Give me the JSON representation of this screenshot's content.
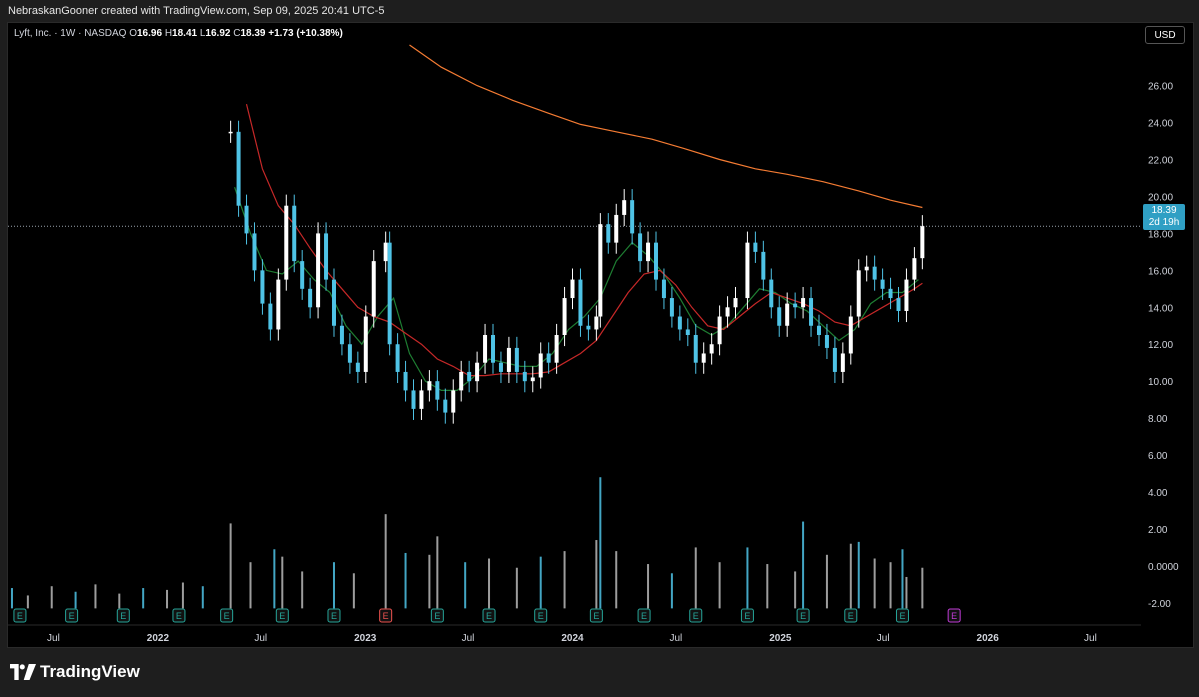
{
  "header": {
    "caption": "NebraskanGooner created with TradingView.com, Sep 09, 2025 20:41 UTC-5"
  },
  "legend": {
    "symbol": "Lyft, Inc. · 1W · NASDAQ",
    "o_label": "O",
    "o_value": "16.96",
    "h_label": "H",
    "h_value": "18.41",
    "l_label": "L",
    "l_value": "16.92",
    "c_label": "C",
    "c_value": "18.39",
    "change": "+1.73 (+10.38%)"
  },
  "price_axis": {
    "currency_label": "USD",
    "last_price": "18.39",
    "countdown": "2d 19h"
  },
  "footer": {
    "brand": "TradingView"
  },
  "colors": {
    "up": "#ffffff",
    "down": "#4fc3e6",
    "ma_short": "#1e7d32",
    "ma_mid": "#c62828",
    "ma_long": "#f57c33",
    "price_tag": "#2f9fc4",
    "earnings_green": "#26a69a",
    "earnings_red": "#ef5350",
    "earnings_future": "#c23cd8"
  },
  "chart_data": {
    "type": "candlestick",
    "symbol": "Lyft, Inc.",
    "interval": "1W",
    "exchange": "NASDAQ",
    "y_ticks": [
      "26.00",
      "24.00",
      "22.00",
      "20.00",
      "18.00",
      "16.00",
      "14.00",
      "12.00",
      "10.00",
      "8.00",
      "6.00",
      "4.00",
      "2.00",
      "0.0000",
      "-2.00"
    ],
    "y_tick_values": [
      26,
      24,
      22,
      20,
      18,
      16,
      14,
      12,
      10,
      8,
      6,
      4,
      2,
      0,
      -2
    ],
    "ylim": [
      -3.2,
      28.2
    ],
    "x_ticks": [
      "Jul",
      "2022",
      "Jul",
      "2023",
      "Jul",
      "2024",
      "Jul",
      "2025",
      "Jul",
      "2026",
      "Jul"
    ],
    "x_tick_dates": [
      "2021-07-01",
      "2022-01-01",
      "2022-07-01",
      "2023-01-01",
      "2023-07-01",
      "2024-01-01",
      "2024-07-01",
      "2025-01-01",
      "2025-07-01",
      "2026-01-01",
      "2026-07-01"
    ],
    "x_start": "2021-04-12",
    "x_end": "2026-09-28",
    "last_close": 18.39,
    "series": [
      {
        "name": "Price",
        "kind": "weekly close (approx.)",
        "points": [
          [
            "2022-05-09",
            23.5
          ],
          [
            "2022-05-23",
            19.5
          ],
          [
            "2022-06-06",
            18.0
          ],
          [
            "2022-06-20",
            16.0
          ],
          [
            "2022-07-04",
            14.2
          ],
          [
            "2022-07-18",
            12.8
          ],
          [
            "2022-08-01",
            15.5
          ],
          [
            "2022-08-15",
            19.5
          ],
          [
            "2022-08-29",
            16.5
          ],
          [
            "2022-09-12",
            15.0
          ],
          [
            "2022-09-26",
            14.0
          ],
          [
            "2022-10-10",
            18.0
          ],
          [
            "2022-10-24",
            15.5
          ],
          [
            "2022-11-07",
            13.0
          ],
          [
            "2022-11-21",
            12.0
          ],
          [
            "2022-12-05",
            11.0
          ],
          [
            "2022-12-19",
            10.5
          ],
          [
            "2023-01-02",
            13.5
          ],
          [
            "2023-01-16",
            16.5
          ],
          [
            "2023-02-06",
            17.5
          ],
          [
            "2023-02-13",
            12.0
          ],
          [
            "2023-02-27",
            10.5
          ],
          [
            "2023-03-13",
            9.5
          ],
          [
            "2023-03-27",
            8.5
          ],
          [
            "2023-04-10",
            9.5
          ],
          [
            "2023-04-24",
            10.0
          ],
          [
            "2023-05-08",
            9.0
          ],
          [
            "2023-05-22",
            8.3
          ],
          [
            "2023-06-05",
            9.5
          ],
          [
            "2023-06-19",
            10.5
          ],
          [
            "2023-07-03",
            10.0
          ],
          [
            "2023-07-17",
            11.0
          ],
          [
            "2023-07-31",
            12.5
          ],
          [
            "2023-08-14",
            11.0
          ],
          [
            "2023-08-28",
            10.5
          ],
          [
            "2023-09-11",
            11.8
          ],
          [
            "2023-09-25",
            10.5
          ],
          [
            "2023-10-09",
            10.0
          ],
          [
            "2023-10-23",
            10.2
          ],
          [
            "2023-11-06",
            11.5
          ],
          [
            "2023-11-20",
            11.0
          ],
          [
            "2023-12-04",
            12.5
          ],
          [
            "2023-12-18",
            14.5
          ],
          [
            "2024-01-01",
            15.5
          ],
          [
            "2024-01-15",
            13.0
          ],
          [
            "2024-01-29",
            12.8
          ],
          [
            "2024-02-12",
            13.5
          ],
          [
            "2024-02-19",
            18.5
          ],
          [
            "2024-03-04",
            17.5
          ],
          [
            "2024-03-18",
            19.0
          ],
          [
            "2024-04-01",
            19.8
          ],
          [
            "2024-04-15",
            18.0
          ],
          [
            "2024-04-29",
            16.5
          ],
          [
            "2024-05-13",
            17.5
          ],
          [
            "2024-05-27",
            15.5
          ],
          [
            "2024-06-10",
            14.5
          ],
          [
            "2024-06-24",
            13.5
          ],
          [
            "2024-07-08",
            12.8
          ],
          [
            "2024-07-22",
            12.5
          ],
          [
            "2024-08-05",
            11.0
          ],
          [
            "2024-08-19",
            11.5
          ],
          [
            "2024-09-02",
            12.0
          ],
          [
            "2024-09-16",
            13.5
          ],
          [
            "2024-09-30",
            14.0
          ],
          [
            "2024-10-14",
            14.5
          ],
          [
            "2024-11-04",
            17.5
          ],
          [
            "2024-11-18",
            17.0
          ],
          [
            "2024-12-02",
            15.5
          ],
          [
            "2024-12-16",
            14.0
          ],
          [
            "2024-12-30",
            13.0
          ],
          [
            "2025-01-13",
            14.2
          ],
          [
            "2025-01-27",
            14.0
          ],
          [
            "2025-02-10",
            14.5
          ],
          [
            "2025-02-24",
            13.0
          ],
          [
            "2025-03-10",
            12.5
          ],
          [
            "2025-03-24",
            11.8
          ],
          [
            "2025-04-07",
            10.5
          ],
          [
            "2025-04-21",
            11.5
          ],
          [
            "2025-05-05",
            13.5
          ],
          [
            "2025-05-19",
            16.0
          ],
          [
            "2025-06-02",
            16.2
          ],
          [
            "2025-06-16",
            15.5
          ],
          [
            "2025-06-30",
            15.0
          ],
          [
            "2025-07-14",
            14.5
          ],
          [
            "2025-07-28",
            13.8
          ],
          [
            "2025-08-11",
            15.5
          ],
          [
            "2025-08-25",
            16.66
          ],
          [
            "2025-09-08",
            18.39
          ]
        ]
      },
      {
        "name": "MA short",
        "points": [
          [
            "2022-05-16",
            20.5
          ],
          [
            "2022-06-13",
            18.0
          ],
          [
            "2022-07-11",
            16.0
          ],
          [
            "2022-08-08",
            15.8
          ],
          [
            "2022-09-05",
            16.5
          ],
          [
            "2022-10-03",
            15.5
          ],
          [
            "2022-10-31",
            14.8
          ],
          [
            "2022-11-28",
            13.0
          ],
          [
            "2022-12-26",
            12.0
          ],
          [
            "2023-01-23",
            13.5
          ],
          [
            "2023-02-20",
            14.5
          ],
          [
            "2023-03-20",
            11.5
          ],
          [
            "2023-04-17",
            10.0
          ],
          [
            "2023-05-15",
            9.5
          ],
          [
            "2023-06-12",
            9.5
          ],
          [
            "2023-07-10",
            10.2
          ],
          [
            "2023-08-07",
            11.2
          ],
          [
            "2023-09-04",
            11.0
          ],
          [
            "2023-10-02",
            10.8
          ],
          [
            "2023-10-30",
            10.8
          ],
          [
            "2023-11-27",
            11.5
          ],
          [
            "2023-12-25",
            12.8
          ],
          [
            "2024-01-22",
            13.5
          ],
          [
            "2024-02-19",
            14.5
          ],
          [
            "2024-03-18",
            16.5
          ],
          [
            "2024-04-15",
            17.5
          ],
          [
            "2024-05-13",
            16.8
          ],
          [
            "2024-06-10",
            15.8
          ],
          [
            "2024-07-08",
            14.5
          ],
          [
            "2024-08-05",
            13.0
          ],
          [
            "2024-09-02",
            12.5
          ],
          [
            "2024-09-30",
            13.0
          ],
          [
            "2024-10-28",
            14.0
          ],
          [
            "2024-11-25",
            15.0
          ],
          [
            "2024-12-23",
            14.8
          ],
          [
            "2025-01-20",
            14.2
          ],
          [
            "2025-02-17",
            13.8
          ],
          [
            "2025-03-17",
            13.0
          ],
          [
            "2025-04-14",
            12.2
          ],
          [
            "2025-05-12",
            12.8
          ],
          [
            "2025-06-09",
            14.2
          ],
          [
            "2025-07-07",
            14.8
          ],
          [
            "2025-08-04",
            14.8
          ],
          [
            "2025-09-01",
            15.5
          ]
        ]
      },
      {
        "name": "MA mid",
        "points": [
          [
            "2022-06-06",
            25.0
          ],
          [
            "2022-07-04",
            21.5
          ],
          [
            "2022-08-01",
            19.5
          ],
          [
            "2022-08-29",
            18.5
          ],
          [
            "2022-09-26",
            17.2
          ],
          [
            "2022-10-24",
            16.0
          ],
          [
            "2022-11-21",
            15.0
          ],
          [
            "2022-12-19",
            14.0
          ],
          [
            "2023-01-16",
            13.5
          ],
          [
            "2023-02-13",
            13.2
          ],
          [
            "2023-03-13",
            12.6
          ],
          [
            "2023-04-10",
            12.0
          ],
          [
            "2023-05-08",
            11.2
          ],
          [
            "2023-06-05",
            10.8
          ],
          [
            "2023-07-03",
            10.3
          ],
          [
            "2023-07-31",
            10.3
          ],
          [
            "2023-08-28",
            10.4
          ],
          [
            "2023-09-25",
            10.4
          ],
          [
            "2023-10-23",
            10.4
          ],
          [
            "2023-11-20",
            10.5
          ],
          [
            "2023-12-18",
            11.0
          ],
          [
            "2024-01-15",
            11.5
          ],
          [
            "2024-02-12",
            12.2
          ],
          [
            "2024-03-11",
            13.5
          ],
          [
            "2024-04-08",
            14.8
          ],
          [
            "2024-05-06",
            15.8
          ],
          [
            "2024-06-03",
            16.0
          ],
          [
            "2024-07-01",
            15.2
          ],
          [
            "2024-07-29",
            14.0
          ],
          [
            "2024-08-26",
            13.0
          ],
          [
            "2024-09-23",
            12.8
          ],
          [
            "2024-10-21",
            13.5
          ],
          [
            "2024-11-18",
            14.2
          ],
          [
            "2024-12-16",
            14.8
          ],
          [
            "2025-01-13",
            14.5
          ],
          [
            "2025-02-10",
            14.2
          ],
          [
            "2025-03-10",
            13.8
          ],
          [
            "2025-04-07",
            13.2
          ],
          [
            "2025-05-05",
            13.0
          ],
          [
            "2025-06-02",
            13.5
          ],
          [
            "2025-06-30",
            14.0
          ],
          [
            "2025-07-28",
            14.5
          ],
          [
            "2025-08-25",
            15.0
          ],
          [
            "2025-09-08",
            15.3
          ]
        ]
      },
      {
        "name": "MA long",
        "points": [
          [
            "2023-03-20",
            28.2
          ],
          [
            "2023-05-15",
            27.0
          ],
          [
            "2023-07-17",
            26.0
          ],
          [
            "2023-09-18",
            25.2
          ],
          [
            "2023-11-20",
            24.5
          ],
          [
            "2024-01-15",
            23.9
          ],
          [
            "2024-03-18",
            23.5
          ],
          [
            "2024-05-20",
            23.1
          ],
          [
            "2024-07-15",
            22.6
          ],
          [
            "2024-09-16",
            22.0
          ],
          [
            "2024-11-18",
            21.5
          ],
          [
            "2025-01-13",
            21.2
          ],
          [
            "2025-03-17",
            20.8
          ],
          [
            "2025-05-19",
            20.3
          ],
          [
            "2025-07-14",
            19.8
          ],
          [
            "2025-09-08",
            19.4
          ]
        ]
      }
    ],
    "volume": {
      "dates": [
        "2021-04-19",
        "2021-05-17",
        "2021-06-28",
        "2021-08-09",
        "2021-09-13",
        "2021-10-25",
        "2021-12-06",
        "2022-01-17",
        "2022-02-14",
        "2022-03-21",
        "2022-05-09",
        "2022-06-13",
        "2022-07-25",
        "2022-08-08",
        "2022-09-12",
        "2022-11-07",
        "2022-12-12",
        "2023-02-06",
        "2023-03-13",
        "2023-04-24",
        "2023-05-08",
        "2023-06-26",
        "2023-08-07",
        "2023-09-25",
        "2023-11-06",
        "2023-12-18",
        "2024-02-12",
        "2024-02-19",
        "2024-03-18",
        "2024-05-13",
        "2024-06-24",
        "2024-08-05",
        "2024-09-16",
        "2024-11-04",
        "2024-12-09",
        "2025-01-27",
        "2025-02-10",
        "2025-03-24",
        "2025-05-05",
        "2025-05-19",
        "2025-06-16",
        "2025-07-14",
        "2025-08-04",
        "2025-08-11",
        "2025-09-08"
      ],
      "values": [
        -1.2,
        -1.6,
        -1.1,
        -1.4,
        -1.0,
        -1.5,
        -1.2,
        -1.3,
        -0.9,
        -1.1,
        2.3,
        0.2,
        0.9,
        0.5,
        -0.3,
        0.2,
        -0.4,
        2.8,
        0.7,
        0.6,
        1.6,
        0.2,
        0.4,
        -0.1,
        0.5,
        0.8,
        1.4,
        4.8,
        0.8,
        0.1,
        -0.4,
        1.0,
        0.2,
        1.0,
        0.1,
        -0.3,
        2.4,
        0.6,
        1.2,
        1.3,
        0.4,
        0.2,
        0.9,
        -0.6,
        -0.1
      ]
    },
    "earnings_markers": {
      "dates": [
        "2021-05-03",
        "2021-08-02",
        "2021-11-01",
        "2022-02-07",
        "2022-05-02",
        "2022-08-08",
        "2022-11-07",
        "2023-02-06",
        "2023-05-08",
        "2023-08-07",
        "2023-11-06",
        "2024-02-12",
        "2024-05-06",
        "2024-08-05",
        "2024-11-04",
        "2025-02-10",
        "2025-05-05",
        "2025-08-04",
        "2025-11-03"
      ],
      "types": [
        "past",
        "past",
        "past",
        "past",
        "past",
        "past",
        "past",
        "miss",
        "past",
        "past",
        "past",
        "past",
        "past",
        "past",
        "past",
        "past",
        "past",
        "past",
        "upcoming"
      ],
      "label": "E"
    }
  }
}
